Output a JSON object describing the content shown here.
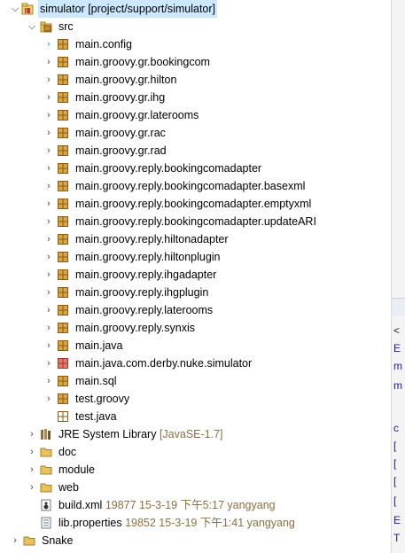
{
  "tree": {
    "project": {
      "name": "simulator",
      "decoration": "[project/support/simulator]"
    },
    "src": "src",
    "packages": [
      {
        "label": "main.config",
        "icon": "package-icon",
        "highlight": true
      },
      {
        "label": "main.groovy.gr.bookingcom",
        "icon": "package-icon"
      },
      {
        "label": "main.groovy.gr.hilton",
        "icon": "package-icon"
      },
      {
        "label": "main.groovy.gr.ihg",
        "icon": "package-icon"
      },
      {
        "label": "main.groovy.gr.laterooms",
        "icon": "package-icon"
      },
      {
        "label": "main.groovy.gr.rac",
        "icon": "package-icon"
      },
      {
        "label": "main.groovy.gr.rad",
        "icon": "package-icon"
      },
      {
        "label": "main.groovy.reply.bookingcomadapter",
        "icon": "package-icon"
      },
      {
        "label": "main.groovy.reply.bookingcomadapter.basexml",
        "icon": "package-icon"
      },
      {
        "label": "main.groovy.reply.bookingcomadapter.emptyxml",
        "icon": "package-icon"
      },
      {
        "label": "main.groovy.reply.bookingcomadapter.updateARI",
        "icon": "package-icon"
      },
      {
        "label": "main.groovy.reply.hiltonadapter",
        "icon": "package-icon"
      },
      {
        "label": "main.groovy.reply.hiltonplugin",
        "icon": "package-icon"
      },
      {
        "label": "main.groovy.reply.ihgadapter",
        "icon": "package-icon"
      },
      {
        "label": "main.groovy.reply.ihgplugin",
        "icon": "package-icon"
      },
      {
        "label": "main.groovy.reply.laterooms",
        "icon": "package-icon"
      },
      {
        "label": "main.groovy.reply.synxis",
        "icon": "package-icon"
      },
      {
        "label": "main.java",
        "icon": "package-icon"
      },
      {
        "label": "main.java.com.derby.nuke.simulator",
        "icon": "package-error-icon"
      },
      {
        "label": "main.sql",
        "icon": "package-icon"
      },
      {
        "label": "test.groovy",
        "icon": "package-icon"
      },
      {
        "label": "test.java",
        "icon": "empty-package-icon",
        "noTwisty": true
      }
    ],
    "jre": {
      "label": "JRE System Library",
      "decoration": "[JavaSE-1.7]"
    },
    "folders": [
      "doc",
      "module",
      "web"
    ],
    "files": [
      {
        "label": "build.xml",
        "decoration": "19877  15-3-19 下午5:17  yangyang"
      },
      {
        "label": "lib.properties",
        "decoration": "19852  15-3-19 下午1:41  yangyang"
      }
    ],
    "snake": "Snake"
  },
  "right_panel": {
    "chars": [
      "<",
      "E",
      "m",
      "m",
      "c",
      "[",
      "[",
      "[",
      "[",
      "E",
      "T"
    ]
  },
  "colors": {
    "selection": "#cce8ff",
    "decoration": "#8d6e3f",
    "package": "#c98a2b",
    "folder": "#e8c25a",
    "link": "#1a1aa6"
  }
}
